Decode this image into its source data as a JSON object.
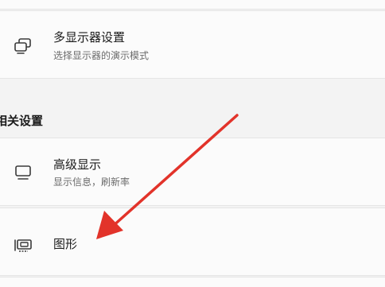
{
  "settings": {
    "multi_display": {
      "title": "多显示器设置",
      "subtitle": "选择显示器的演示模式",
      "icon": "multi-display-icon"
    },
    "related_settings": {
      "header": "相关设置"
    },
    "advanced_display": {
      "title": "高级显示",
      "subtitle": "显示信息，刷新率",
      "icon": "monitor-icon"
    },
    "graphics": {
      "title": "图形",
      "icon": "graphics-card-icon"
    }
  },
  "annotation": {
    "color": "#e2332a"
  }
}
